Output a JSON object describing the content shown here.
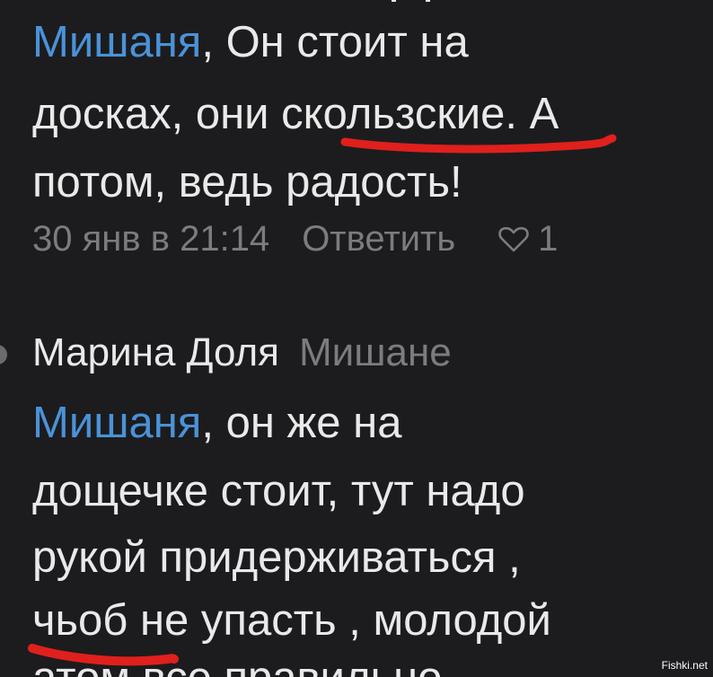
{
  "comment1": {
    "mention": "Мишаня",
    "line1_rest": ", Он стоит на",
    "line2_before": "досках, они ",
    "line2_marked": "скользские",
    "line2_after": ". А",
    "line3": "потом, ведь радость!",
    "date": "30 янв в 21:14",
    "reply_label": "Ответить",
    "like_count": "1"
  },
  "comment2": {
    "author": "Марина Доля",
    "reply_to": "Мишане",
    "mention": "Мишаня",
    "line1_rest": ", он же на",
    "line2": "дощечке стоит, тут надо",
    "line3": "рукой придерживаться ,",
    "line4_marked": "чьоб",
    "line4_rest": " не упасть , молодой",
    "line5_partial": "атом все правильно"
  },
  "annotation_color": "#e0201c",
  "mention_color": "#4a92d8",
  "watermark": "Fishki.net",
  "icons": {
    "like": "heart-icon"
  }
}
